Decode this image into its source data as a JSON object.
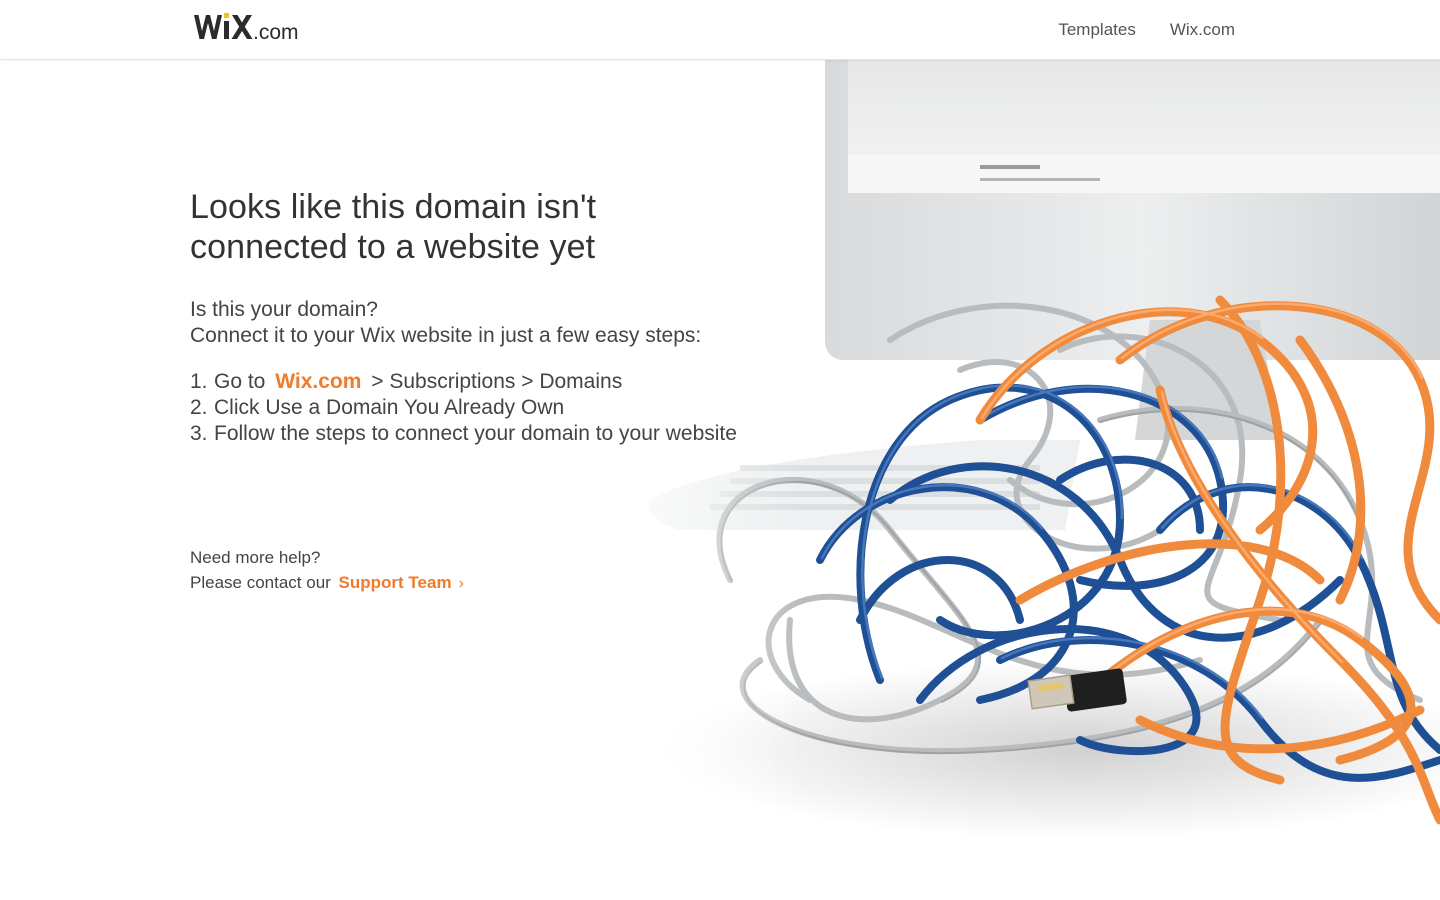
{
  "header": {
    "logo_text_main": "WiX",
    "logo_text_suffix": ".com",
    "nav": [
      {
        "label": "Templates"
      },
      {
        "label": "Wix.com"
      }
    ]
  },
  "main": {
    "title_line1": "Looks like this domain isn't",
    "title_line2": "connected to a website yet",
    "question": "Is this your domain?",
    "subtitle": "Connect it to your Wix website in just a few easy steps:",
    "steps": [
      {
        "num": "1.",
        "before": "Go to",
        "link": "Wix.com",
        "after": "> Subscriptions > Domains"
      },
      {
        "num": "2.",
        "text": "Click Use a Domain You Already Own"
      },
      {
        "num": "3.",
        "text": "Follow the steps to connect your domain to your website"
      }
    ],
    "help_title": "Need more help?",
    "contact_prefix": "Please contact our",
    "support_link": "Support Team",
    "support_chevron": "›"
  },
  "colors": {
    "accent": "#f07b2b",
    "text": "#3a3a3a",
    "cable_blue": "#1f4f95",
    "cable_orange": "#f08a3c",
    "cable_silver": "#b8bcbf"
  },
  "icons": {
    "logo": "wix-logo",
    "chevron": "chevron-right-icon",
    "illustration": "tangled-cables-illustration"
  }
}
